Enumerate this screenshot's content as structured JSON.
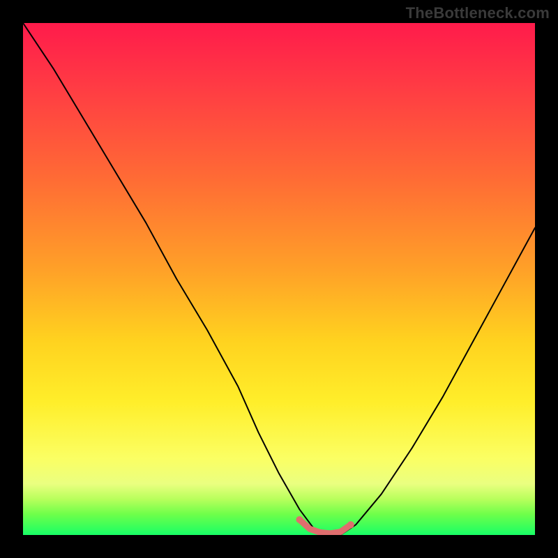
{
  "watermark": "TheBottleneck.com",
  "chart_data": {
    "type": "line",
    "title": "",
    "xlabel": "",
    "ylabel": "",
    "xlim": [
      0,
      100
    ],
    "ylim": [
      0,
      100
    ],
    "note": "Axes are unlabeled; values are estimated as percentages of plot width/height read from pixel positions.",
    "series": [
      {
        "name": "curve",
        "color": "#000000",
        "x": [
          0,
          6,
          12,
          18,
          24,
          30,
          36,
          42,
          46,
          50,
          54,
          57,
          60,
          62,
          65,
          70,
          76,
          82,
          88,
          94,
          100
        ],
        "y": [
          100,
          91,
          81,
          71,
          61,
          50,
          40,
          29,
          20,
          12,
          5,
          1,
          0,
          0,
          2,
          8,
          17,
          27,
          38,
          49,
          60
        ]
      }
    ],
    "highlight": {
      "name": "min-plateau",
      "color": "#e06a6a",
      "x": [
        54,
        56,
        58,
        60,
        62,
        64
      ],
      "y": [
        3,
        1.2,
        0.5,
        0.3,
        0.6,
        2
      ]
    }
  }
}
